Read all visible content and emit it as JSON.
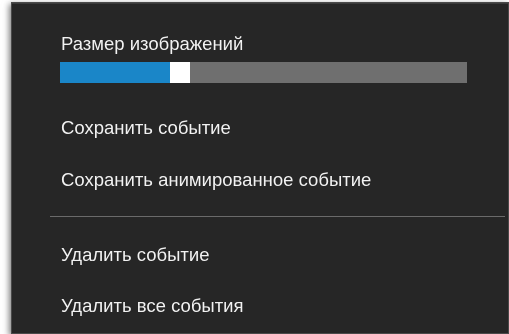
{
  "menu": {
    "slider": {
      "label": "Размер изображений",
      "value_fraction": 0.27,
      "fill_color": "#1a86c8",
      "track_color": "#6f6f6f"
    },
    "items": [
      {
        "label": "Сохранить событие"
      },
      {
        "label": "Сохранить анимированное событие"
      },
      {
        "label": "Удалить событие"
      },
      {
        "label": "Удалить все события"
      }
    ]
  }
}
